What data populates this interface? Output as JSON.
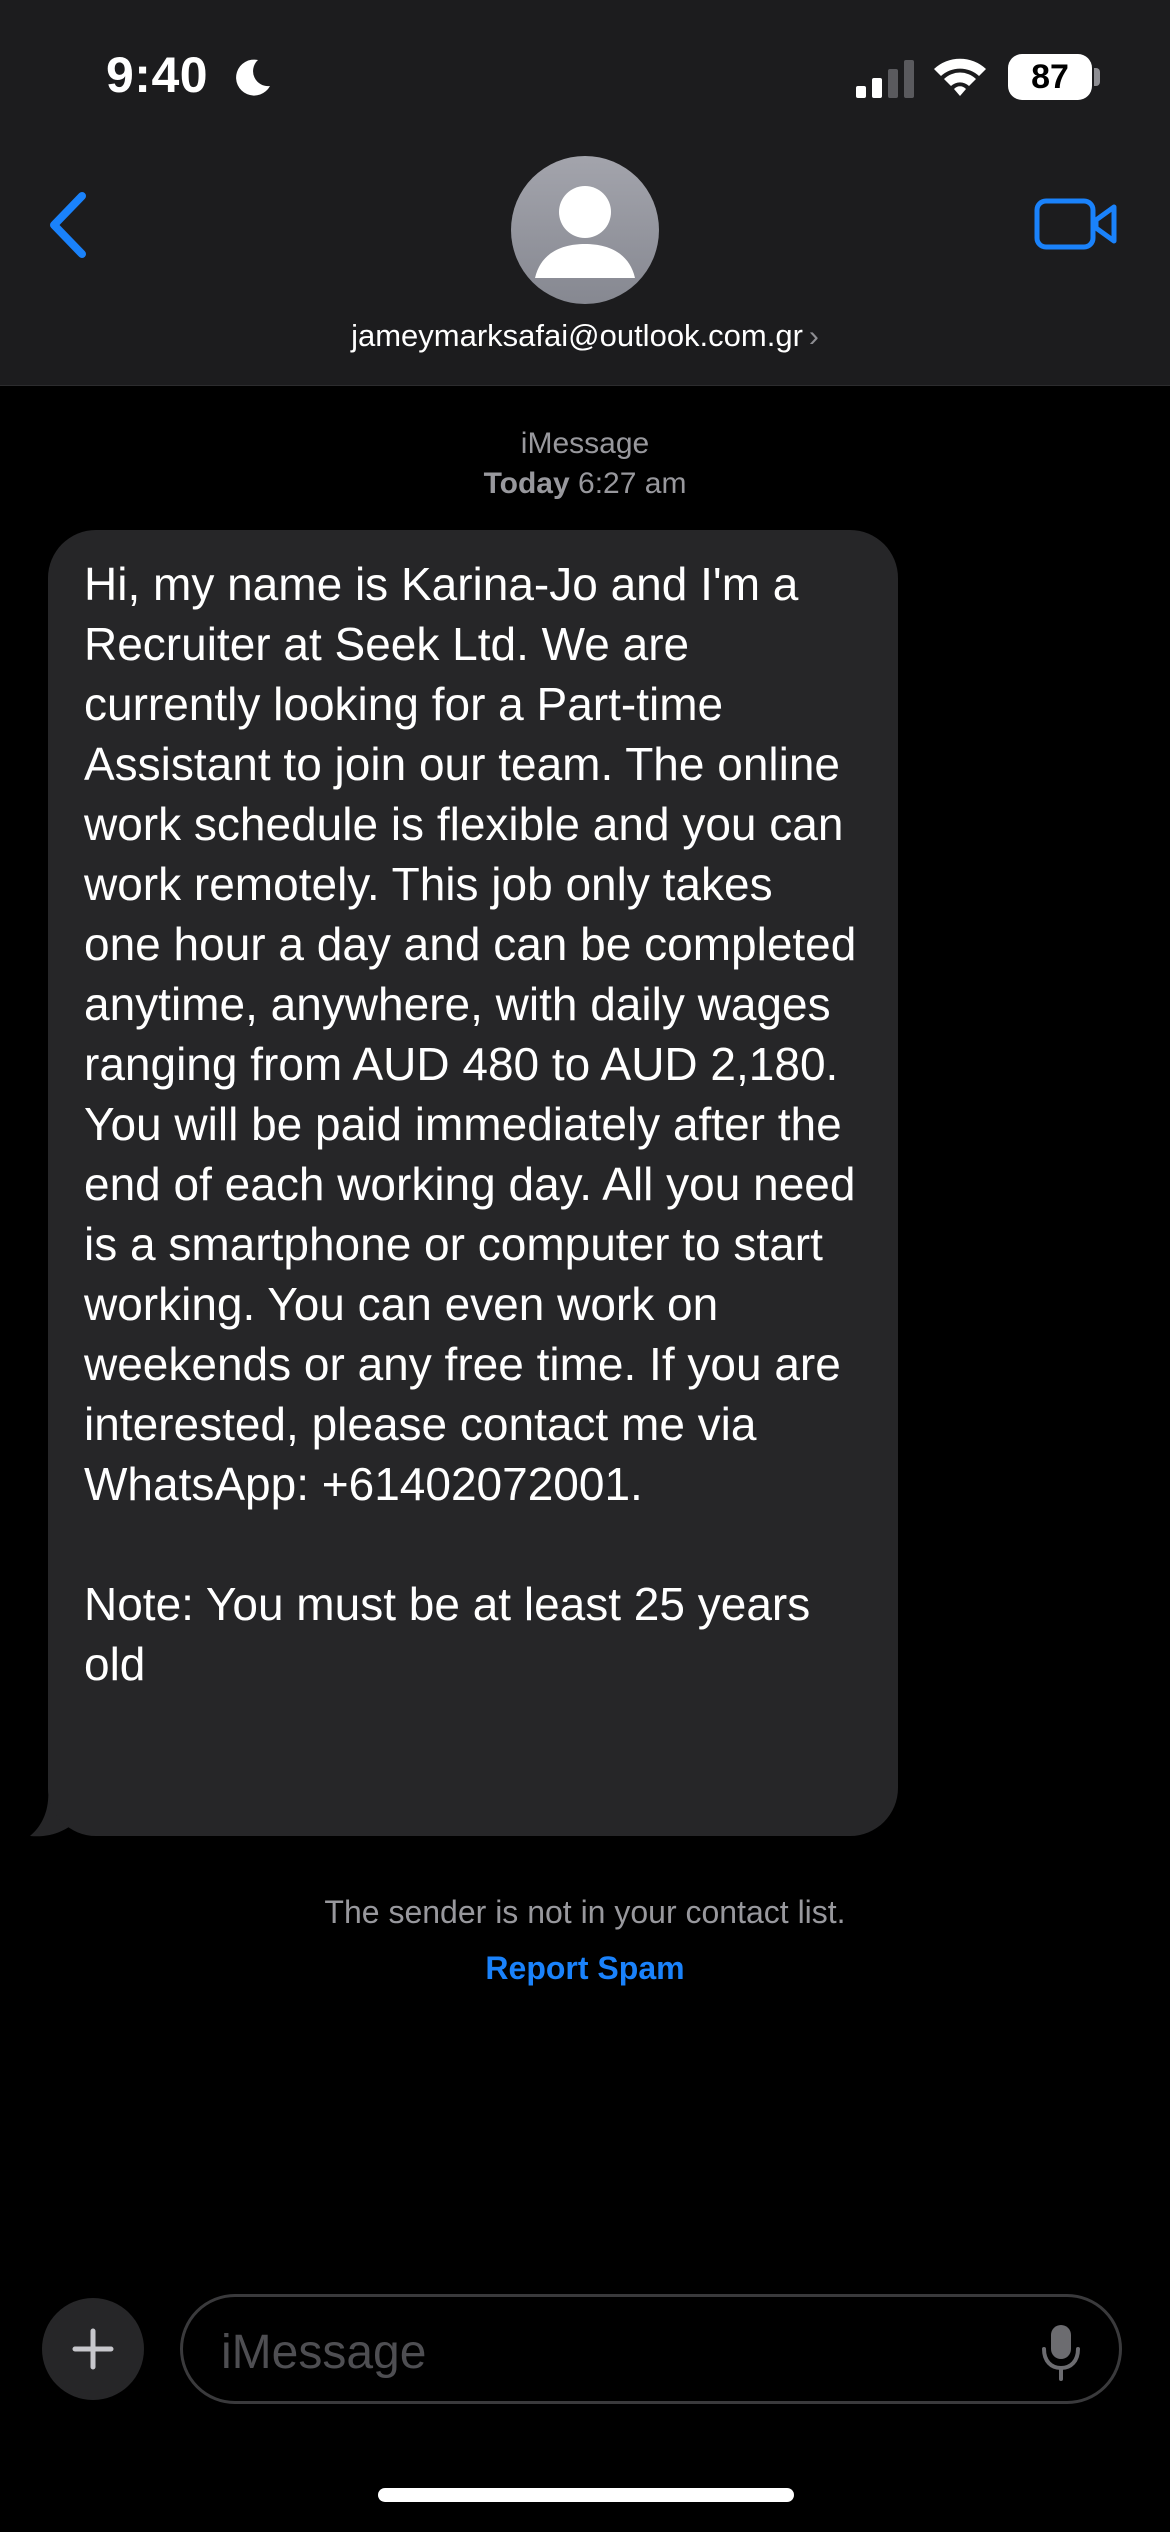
{
  "status_bar": {
    "time": "9:40",
    "battery": "87"
  },
  "header": {
    "contact": "jameymarksafai@outlook.com.gr",
    "chevron": "›"
  },
  "conversation": {
    "service": "iMessage",
    "day": "Today",
    "time": "6:27 am",
    "message": "Hi, my name is Karina-Jo and I'm a Recruiter at Seek Ltd. We are currently looking for a Part-time Assistant to join our team. The online work schedule is flexible and you can work remotely. This job only takes one hour a day and can be completed anytime, anywhere, with daily wages ranging from AUD 480 to AUD 2,180. You will be paid immediately after the end of each working day. All you need is a smartphone or computer to start working. You can even work on weekends or any free time. If you are interested, please contact me via WhatsApp: +61402072001.\n\nNote: You must be at least 25 years old",
    "notice": "The sender is not in your contact list.",
    "report_spam": "Report Spam"
  },
  "composer": {
    "placeholder": "iMessage"
  },
  "colors": {
    "accent": "#1a82fb",
    "bubble": "#262628",
    "header": "#1c1c1e"
  }
}
